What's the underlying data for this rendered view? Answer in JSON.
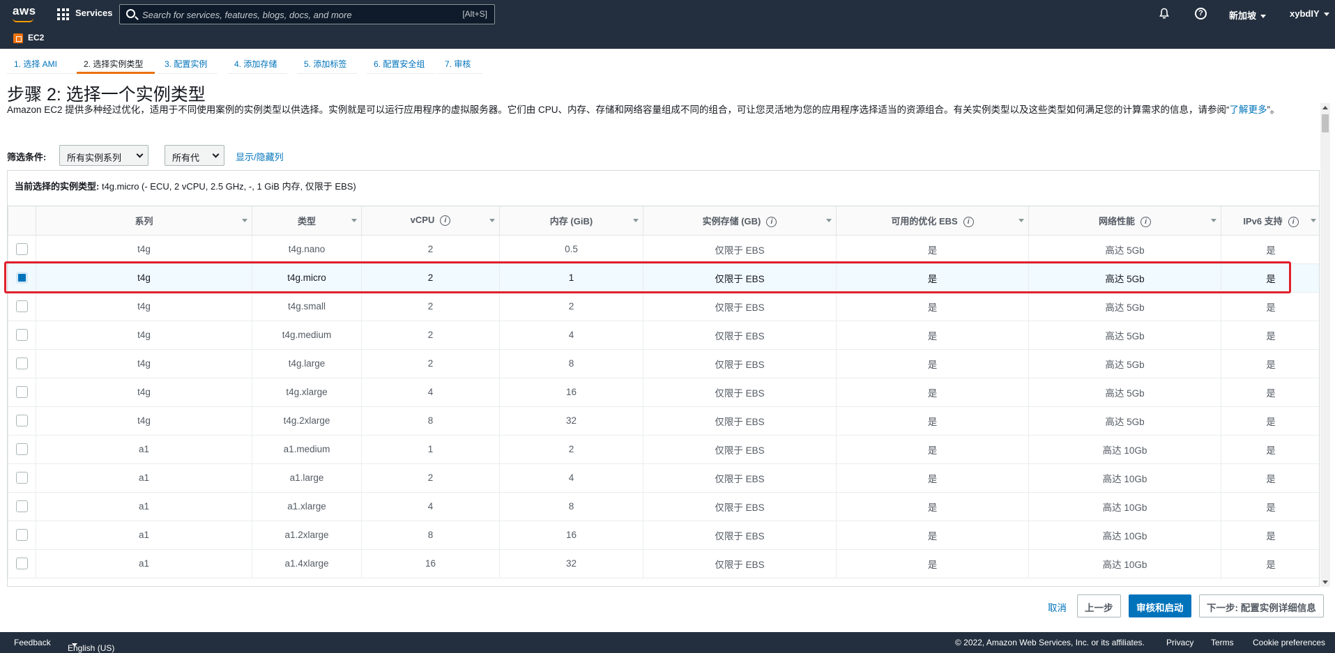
{
  "nav": {
    "logo": "aws",
    "services": "Services",
    "search_placeholder": "Search for services, features, blogs, docs, and more",
    "search_shortcut": "[Alt+S]",
    "help_icon": "?",
    "region": "新加坡",
    "user": "xybdIY",
    "service_badge": "EC2"
  },
  "wizard": {
    "tabs": [
      "1. 选择 AMI",
      "2. 选择实例类型",
      "3. 配置实例",
      "4. 添加存储",
      "5. 添加标签",
      "6. 配置安全组",
      "7. 审核"
    ],
    "active_index": 1
  },
  "page": {
    "title": "步骤 2: 选择一个实例类型",
    "description": "Amazon EC2 提供多种经过优化，适用于不同使用案例的实例类型以供选择。实例就是可以运行应用程序的虚拟服务器。它们由 CPU、内存、存储和网络容量组成不同的组合，可让您灵活地为您的应用程序选择适当的资源组合。有关实例类型以及这些类型如何满足您的计算需求的信息，请参阅“",
    "learn_more": "了解更多",
    "description_end": "”。"
  },
  "filters": {
    "label": "筛选条件:",
    "family_select": "所有实例系列",
    "generation_select": "所有代",
    "toggle_columns": "显示/隐藏列"
  },
  "current_selection": {
    "label": "当前选择的实例类型:",
    "value": "t4g.micro (- ECU, 2 vCPU, 2.5 GHz, -, 1 GiB 内存, 仅限于 EBS)"
  },
  "table": {
    "headers": [
      "系列",
      "类型",
      "vCPU",
      "内存 (GiB)",
      "实例存储 (GB)",
      "可用的优化 EBS",
      "网络性能",
      "IPv6 支持"
    ],
    "info_icon": "i",
    "rows": [
      {
        "family": "t4g",
        "type": "t4g.nano",
        "vcpu": "2",
        "memory": "0.5",
        "storage": "仅限于 EBS",
        "ebs": "是",
        "network": "高达 5Gb",
        "ipv6": "是",
        "selected": false
      },
      {
        "family": "t4g",
        "type": "t4g.micro",
        "vcpu": "2",
        "memory": "1",
        "storage": "仅限于 EBS",
        "ebs": "是",
        "network": "高达 5Gb",
        "ipv6": "是",
        "selected": true
      },
      {
        "family": "t4g",
        "type": "t4g.small",
        "vcpu": "2",
        "memory": "2",
        "storage": "仅限于 EBS",
        "ebs": "是",
        "network": "高达 5Gb",
        "ipv6": "是",
        "selected": false
      },
      {
        "family": "t4g",
        "type": "t4g.medium",
        "vcpu": "2",
        "memory": "4",
        "storage": "仅限于 EBS",
        "ebs": "是",
        "network": "高达 5Gb",
        "ipv6": "是",
        "selected": false
      },
      {
        "family": "t4g",
        "type": "t4g.large",
        "vcpu": "2",
        "memory": "8",
        "storage": "仅限于 EBS",
        "ebs": "是",
        "network": "高达 5Gb",
        "ipv6": "是",
        "selected": false
      },
      {
        "family": "t4g",
        "type": "t4g.xlarge",
        "vcpu": "4",
        "memory": "16",
        "storage": "仅限于 EBS",
        "ebs": "是",
        "network": "高达 5Gb",
        "ipv6": "是",
        "selected": false
      },
      {
        "family": "t4g",
        "type": "t4g.2xlarge",
        "vcpu": "8",
        "memory": "32",
        "storage": "仅限于 EBS",
        "ebs": "是",
        "network": "高达 5Gb",
        "ipv6": "是",
        "selected": false
      },
      {
        "family": "a1",
        "type": "a1.medium",
        "vcpu": "1",
        "memory": "2",
        "storage": "仅限于 EBS",
        "ebs": "是",
        "network": "高达 10Gb",
        "ipv6": "是",
        "selected": false
      },
      {
        "family": "a1",
        "type": "a1.large",
        "vcpu": "2",
        "memory": "4",
        "storage": "仅限于 EBS",
        "ebs": "是",
        "network": "高达 10Gb",
        "ipv6": "是",
        "selected": false
      },
      {
        "family": "a1",
        "type": "a1.xlarge",
        "vcpu": "4",
        "memory": "8",
        "storage": "仅限于 EBS",
        "ebs": "是",
        "network": "高达 10Gb",
        "ipv6": "是",
        "selected": false
      },
      {
        "family": "a1",
        "type": "a1.2xlarge",
        "vcpu": "8",
        "memory": "16",
        "storage": "仅限于 EBS",
        "ebs": "是",
        "network": "高达 10Gb",
        "ipv6": "是",
        "selected": false
      },
      {
        "family": "a1",
        "type": "a1.4xlarge",
        "vcpu": "16",
        "memory": "32",
        "storage": "仅限于 EBS",
        "ebs": "是",
        "network": "高达 10Gb",
        "ipv6": "是",
        "selected": false
      }
    ]
  },
  "actions": {
    "cancel": "取消",
    "previous": "上一步",
    "review_launch": "审核和启动",
    "next": "下一步: 配置实例详细信息"
  },
  "footer": {
    "feedback": "Feedback",
    "language": "English (US)",
    "copyright": "© 2022, Amazon Web Services, Inc. or its affiliates.",
    "privacy": "Privacy",
    "terms": "Terms",
    "cookies": "Cookie preferences"
  },
  "colors": {
    "nav_bg": "#232f3e",
    "accent_orange": "#ec7211",
    "link_blue": "#0073bb",
    "highlight_red": "#e0202c"
  }
}
